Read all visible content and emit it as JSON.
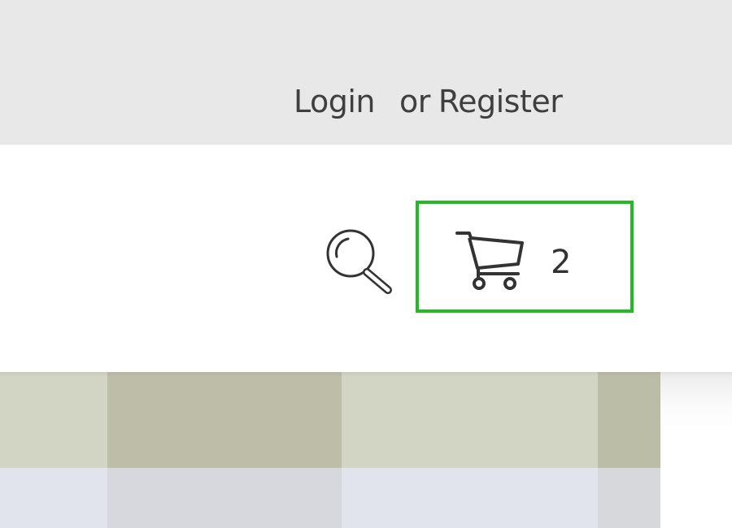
{
  "top_bar": {
    "login_label": "Login",
    "or_text": "or",
    "register_label": "Register"
  },
  "header": {
    "search_icon": "search-icon",
    "cart": {
      "icon": "shopping-cart-icon",
      "count": "2",
      "highlight_color": "#22bb22"
    }
  },
  "colors": {
    "top_bar_background": "#e8e8e8",
    "header_background": "#ffffff",
    "text": "#3f3f3f"
  },
  "hero": {
    "image": "gingham-fabric-photo"
  }
}
